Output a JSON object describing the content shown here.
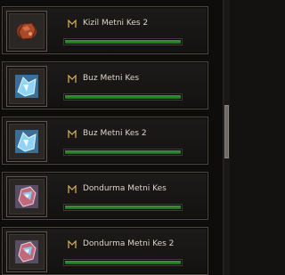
{
  "items": [
    {
      "name": "Kizil Metni Kes 2",
      "icon": "red-ore-icon",
      "progress": 1.0
    },
    {
      "name": "Buz Metni Kes",
      "icon": "ice-crystal-icon",
      "progress": 1.0
    },
    {
      "name": "Buz Metni Kes 2",
      "icon": "ice-crystal-icon",
      "progress": 1.0
    },
    {
      "name": "Dondurma Metni Kes",
      "icon": "frozen-ore-icon",
      "progress": 1.0
    },
    {
      "name": "Dondurma Metni Kes 2",
      "icon": "frozen-ore-icon",
      "progress": 1.0
    }
  ],
  "tag_icon": "rune-tag-icon",
  "colors": {
    "progress_fill": "#2f8a2e",
    "text": "#dcd6cc"
  }
}
